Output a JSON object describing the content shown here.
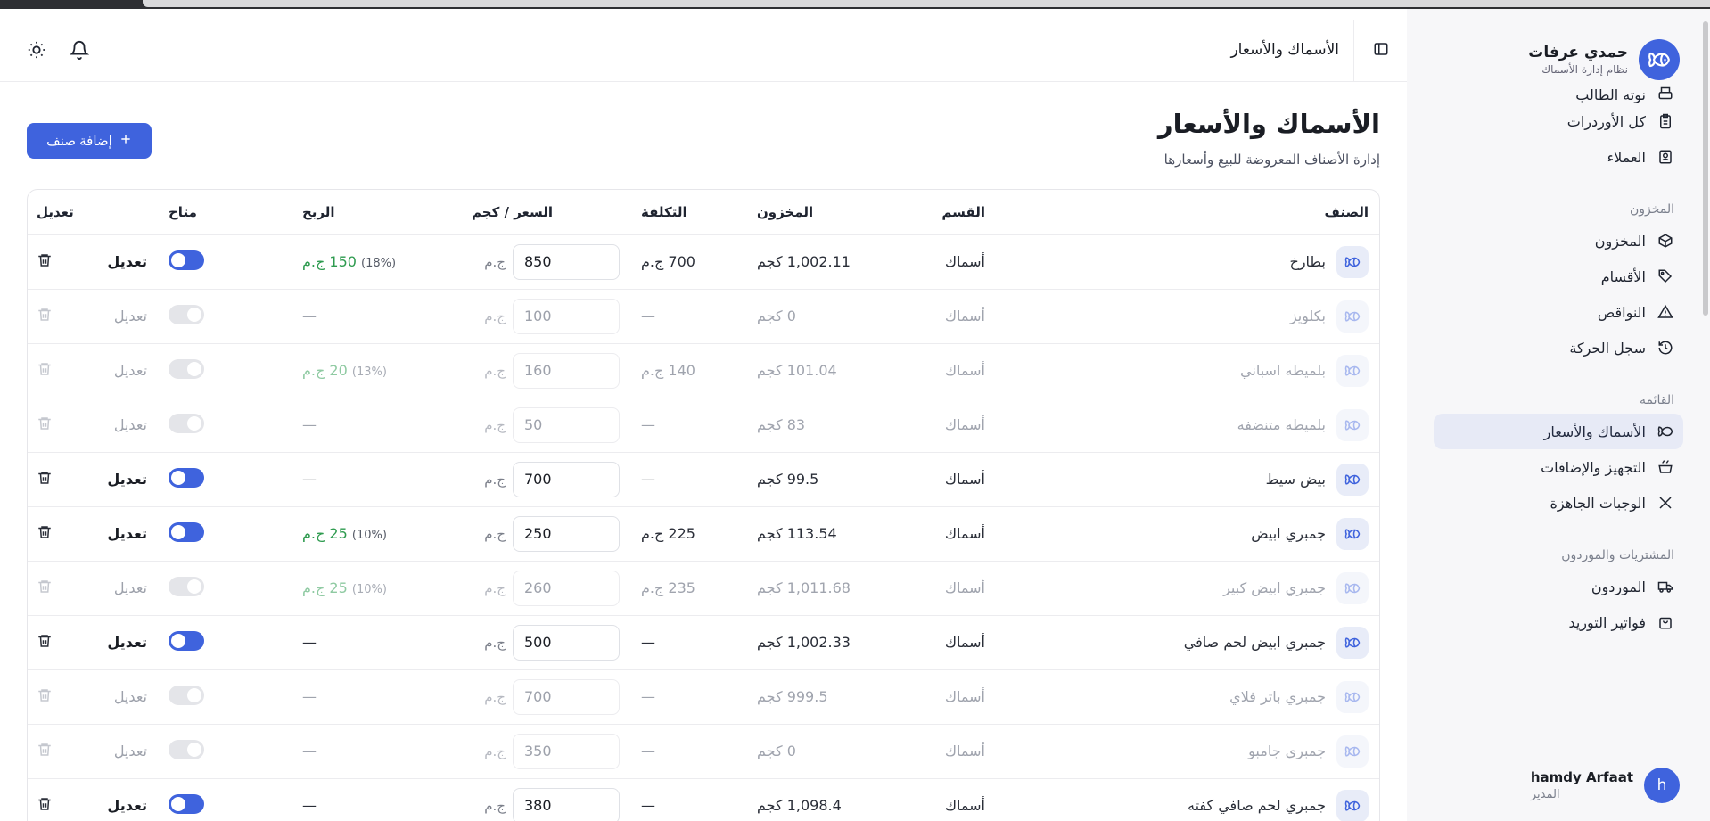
{
  "brand": {
    "title": "حمدي عرفات",
    "subtitle": "نظام إدارة الأسماك"
  },
  "sidebar": {
    "top_items": [
      {
        "label": "نوته الطالب",
        "icon": "printer-icon"
      },
      {
        "label": "كل الأوردرات",
        "icon": "clipboard-icon"
      },
      {
        "label": "العملاء",
        "icon": "contact-card-icon"
      }
    ],
    "sections": [
      {
        "title": "المخزون",
        "items": [
          {
            "label": "المخزون",
            "icon": "box-icon"
          },
          {
            "label": "الأقسام",
            "icon": "tag-icon"
          },
          {
            "label": "النواقص",
            "icon": "warning-icon"
          },
          {
            "label": "سجل الحركة",
            "icon": "history-icon"
          }
        ]
      },
      {
        "title": "القائمة",
        "items": [
          {
            "label": "الأسماك والأسعار",
            "icon": "fish-icon",
            "active": true
          },
          {
            "label": "التجهيز والإضافات",
            "icon": "cooking-pot-icon"
          },
          {
            "label": "الوجبات الجاهزة",
            "icon": "utensils-icon"
          }
        ]
      },
      {
        "title": "المشتريات والموردون",
        "items": [
          {
            "label": "الموردون",
            "icon": "truck-icon"
          },
          {
            "label": "فواتير التوريد",
            "icon": "shopping-bag-icon"
          }
        ]
      }
    ]
  },
  "user": {
    "initial": "h",
    "name": "hamdy Arfaat",
    "role": "المدير"
  },
  "header": {
    "title": "الأسماك والأسعار"
  },
  "page": {
    "title": "الأسماك والأسعار",
    "subtitle": "إدارة الأصناف المعروضة للبيع وأسعارها",
    "add_button": "إضافة صنف"
  },
  "table": {
    "columns": {
      "item": "الصنف",
      "category": "القسم",
      "stock": "المخزون",
      "cost": "التكلفة",
      "price": "السعر / كجم",
      "profit": "الربح",
      "available": "متاح",
      "edit": "تعديل"
    },
    "currency": "ج.م",
    "edit_label": "تعديل",
    "rows": [
      {
        "name": "بطارخ",
        "category": "أسماك",
        "stock": "1,002.11 كجم",
        "cost": "700 ج.م",
        "price": "850",
        "profit": "150 ج.م",
        "profit_pct": "(18%)",
        "available": true
      },
      {
        "name": "بكلويز",
        "category": "أسماك",
        "stock": "0 كجم",
        "cost": "—",
        "price": "100",
        "profit": "—",
        "profit_pct": "",
        "available": false
      },
      {
        "name": "بلميطه اسباني",
        "category": "أسماك",
        "stock": "101.04 كجم",
        "cost": "140 ج.م",
        "price": "160",
        "profit": "20 ج.م",
        "profit_pct": "(13%)",
        "available": false
      },
      {
        "name": "بلميطه متنضفه",
        "category": "أسماك",
        "stock": "83 كجم",
        "cost": "—",
        "price": "50",
        "profit": "—",
        "profit_pct": "",
        "available": false
      },
      {
        "name": "بيض سيط",
        "category": "أسماك",
        "stock": "99.5 كجم",
        "cost": "—",
        "price": "700",
        "profit": "—",
        "profit_pct": "",
        "available": true
      },
      {
        "name": "جمبري ابيض",
        "category": "أسماك",
        "stock": "113.54 كجم",
        "cost": "225 ج.م",
        "price": "250",
        "profit": "25 ج.م",
        "profit_pct": "(10%)",
        "available": true
      },
      {
        "name": "جمبري ابيض كبير",
        "category": "أسماك",
        "stock": "1,011.68 كجم",
        "cost": "235 ج.م",
        "price": "260",
        "profit": "25 ج.م",
        "profit_pct": "(10%)",
        "available": false
      },
      {
        "name": "جمبري ابيض لحم صافي",
        "category": "أسماك",
        "stock": "1,002.33 كجم",
        "cost": "—",
        "price": "500",
        "profit": "—",
        "profit_pct": "",
        "available": true
      },
      {
        "name": "جمبري باتر فلاي",
        "category": "أسماك",
        "stock": "999.5 كجم",
        "cost": "—",
        "price": "700",
        "profit": "—",
        "profit_pct": "",
        "available": false
      },
      {
        "name": "جمبري جامبو",
        "category": "أسماك",
        "stock": "0 كجم",
        "cost": "—",
        "price": "350",
        "profit": "—",
        "profit_pct": "",
        "available": false
      },
      {
        "name": "جمبري لحم صافي كفته",
        "category": "أسماك",
        "stock": "1,098.4 كجم",
        "cost": "—",
        "price": "380",
        "profit": "—",
        "profit_pct": "",
        "available": true
      }
    ]
  },
  "colors": {
    "accent": "#3f63dd",
    "profit": "#2e9b4f"
  }
}
